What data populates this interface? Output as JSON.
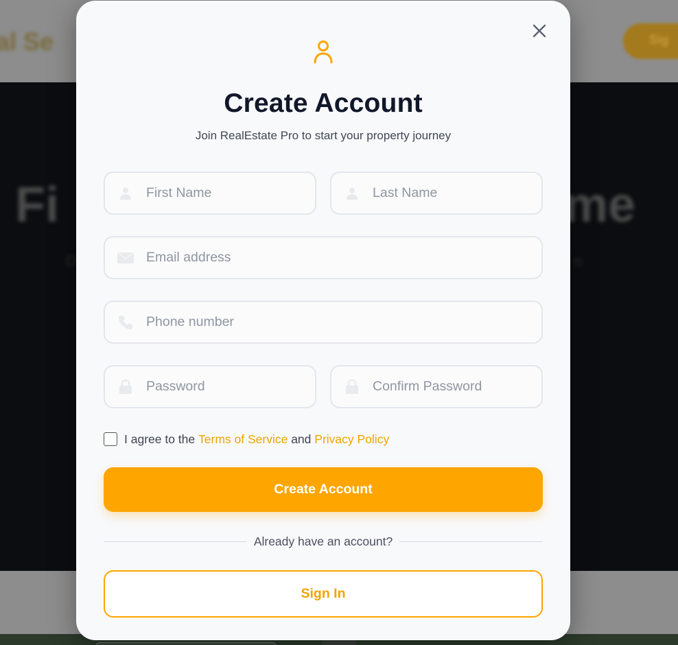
{
  "background": {
    "logo_fragment": "al Se",
    "header_button_fragment": "Sig",
    "hero_title_left": "Fi",
    "hero_title_right": "me",
    "hero_sub_left": "D",
    "hero_sub_right": "n"
  },
  "modal": {
    "icons": {
      "header": "user-icon",
      "close": "close-icon"
    },
    "title": "Create Account",
    "subtitle": "Join RealEstate Pro to start your property journey",
    "fields": {
      "first_name": {
        "placeholder": "First Name",
        "value": "",
        "icon": "user-icon"
      },
      "last_name": {
        "placeholder": "Last Name",
        "value": "",
        "icon": "user-icon"
      },
      "email": {
        "placeholder": "Email address",
        "value": "",
        "icon": "mail-icon"
      },
      "phone": {
        "placeholder": "Phone number",
        "value": "",
        "icon": "phone-icon"
      },
      "password": {
        "placeholder": "Password",
        "value": "",
        "icon": "lock-icon"
      },
      "confirm_password": {
        "placeholder": "Confirm Password",
        "value": "",
        "icon": "lock-icon"
      }
    },
    "agreement": {
      "checked": false,
      "prefix": "I agree to the",
      "terms_link": "Terms of Service",
      "conjunction": "and",
      "privacy_link": "Privacy Policy"
    },
    "create_button": "Create Account",
    "divider_text": "Already have an account?",
    "signin_button": "Sign In"
  },
  "colors": {
    "accent": "#ffa500",
    "link": "#f2a300",
    "title": "#12182a",
    "modal_bg": "#f8f9fb"
  }
}
